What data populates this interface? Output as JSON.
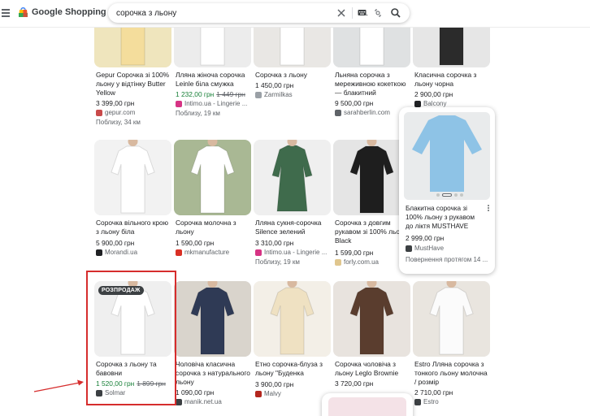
{
  "header": {
    "logo_text": "Google Shopping",
    "search_value": "сорочка з льону",
    "icons": [
      "menu-icon",
      "google-shopping-bag-icon",
      "close-icon",
      "keyboard-icon",
      "google-lens-icon",
      "search-icon"
    ]
  },
  "products": [
    {
      "title": "Gepur Сорочка зі 100% льону у відтінку Butter Yellow",
      "price": "3 399,00 грн",
      "store": "gepur.com",
      "distance": "Поблизу, 34 км",
      "img": "#efe5bd",
      "figure": "#f4dd9c",
      "favicon": "#c94a4a"
    },
    {
      "title": "Лляна жіноча сорочка Leinle біла смужка",
      "price": "1 232,00 грн",
      "old_price": "1 449 грн",
      "sale": true,
      "store": "Intimo.ua - Lingerie ...",
      "distance": "Поблизу, 19 км",
      "img": "#ececec",
      "figure": "#ffffff",
      "favicon": "#d63384"
    },
    {
      "title": "Сорочка з льону",
      "price": "1 450,00 грн",
      "store": "Zarmilkas",
      "img": "#e9e7e4",
      "figure": "#ffffff",
      "favicon": "#9aa0a6"
    },
    {
      "title": "Льняна сорочка з мереживною кокеткою — блакитний",
      "price": "9 500,00 грн",
      "store": "sarahberlin.com",
      "img": "#dfe1e2",
      "figure": "#ffffff",
      "favicon": "#5f6368"
    },
    {
      "title": "Класична сорочка з льону чорна",
      "price": "2 900,00 грн",
      "store": "Balcony",
      "img": "#e6e6e6",
      "figure": "#2b2b2b",
      "favicon": "#202124"
    },
    {
      "title": "Сорочка вільного крою з льону біла",
      "price": "5 900,00 грн",
      "store": "Morandi.ua",
      "img": "#f2f2f2",
      "figure": "#ffffff",
      "favicon": "#202124"
    },
    {
      "title": "Сорочка молочна з льону",
      "price": "1 590,00 грн",
      "store": "mkmanufacture",
      "img": "#a9b894",
      "figure": "#ffffff",
      "favicon": "#d93025"
    },
    {
      "title": "Лляна сукня-сорочка Silence зелений",
      "price": "3 310,00 грн",
      "store": "Intimo.ua - Lingerie ...",
      "distance": "Поблизу, 19 км",
      "img": "#efefef",
      "figure": "#3f6b4c",
      "favicon": "#d63384"
    },
    {
      "title": "Сорочка з довгим рукавом зі 100% льону Black",
      "price": "1 599,00 грн",
      "store": "forly.com.ua",
      "img": "#e5e5e5",
      "figure": "#1e1e1e",
      "favicon": "#e0c68e"
    },
    {
      "title": "Сорочка з льону та бавовни",
      "price": "1 520,00 грн",
      "old_price": "1 899 грн",
      "sale": true,
      "store": "Solmar",
      "badge": "РОЗПРОДАЖ",
      "img": "#efefef",
      "figure": "#ffffff",
      "favicon": "#3c4043"
    },
    {
      "title": "Чоловіча класична сорочка з натурального льону",
      "price": "1 090,00 грн",
      "store": "manik.net.ua",
      "img": "#d9d4cc",
      "figure": "#2f3a55",
      "favicon": "#3c4043"
    },
    {
      "title": "Етно сорочка-блуза з льону \"Буденка",
      "price": "3 900,00 грн",
      "store": "Malvy",
      "img": "#f3efe7",
      "figure": "#efe1c2",
      "favicon": "#b3261e"
    },
    {
      "title": "Сорочка чоловіча з льону Leglo Brownie",
      "price": "3 720,00 грн",
      "store": "",
      "img": "#e8e3de",
      "figure": "#5a3d2e",
      "favicon": "#8a6a50"
    },
    {
      "title": "Estro Лляна сорочка з тонкого льону молочна / розмір",
      "price": "2 710,00 грн",
      "store": "Estro",
      "img": "#e9e5df",
      "figure": "#fbfbfb",
      "favicon": "#3c4043"
    }
  ],
  "popup": {
    "title": "Блакитна сорочка зі 100% льону з рукавом до ліктя MUSTHAVE",
    "price": "2 999,00 грн",
    "store": "MustHave",
    "return": "Повернення протягом 14 ...",
    "img": "#e9ebec",
    "figure": "#8ec3e6",
    "favicon": "#3c4043"
  },
  "colors": {
    "sale_green": "#188038",
    "highlight_red": "#d62d2d",
    "badge_bg": "#3c4043"
  }
}
